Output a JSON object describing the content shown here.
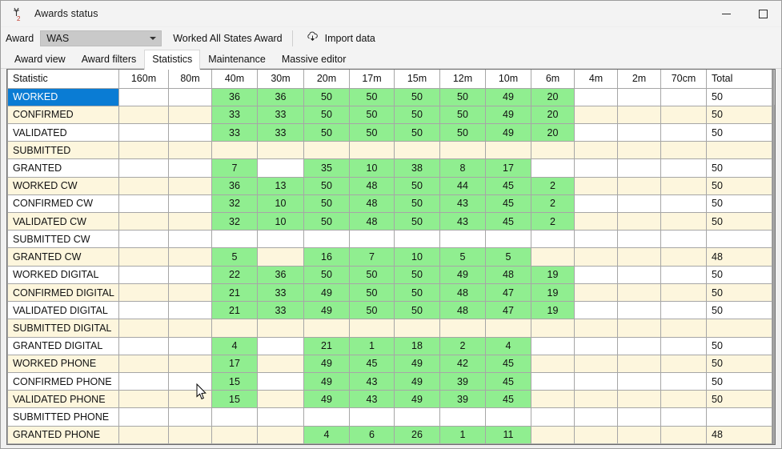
{
  "window": {
    "title": "Awards status",
    "icon": "antenna-icon",
    "minimize_label": "Minimize",
    "maximize_label": "Maximize"
  },
  "toolbar": {
    "award_label": "Award",
    "award_value": "WAS",
    "award_placeholder": "WAS",
    "award_description": "Worked All States Award",
    "import_label": "Import data",
    "import_icon": "cloud-download-icon"
  },
  "tabs": [
    {
      "label": "Award view",
      "active": false
    },
    {
      "label": "Award filters",
      "active": false
    },
    {
      "label": "Statistics",
      "active": true
    },
    {
      "label": "Maintenance",
      "active": false
    },
    {
      "label": "Massive editor",
      "active": false
    }
  ],
  "colors": {
    "green": "#90ee90",
    "cream": "#fdf6dd",
    "white": "#ffffff",
    "selection_blue": "#0a7cd4",
    "grid_line": "#a6a6a6"
  },
  "table": {
    "columns": [
      "Statistic",
      "160m",
      "80m",
      "40m",
      "30m",
      "20m",
      "17m",
      "15m",
      "12m",
      "10m",
      "6m",
      "4m",
      "2m",
      "70cm",
      "Total"
    ],
    "rows": [
      {
        "statistic": "WORKED",
        "selected": true,
        "values": [
          "",
          "",
          "36",
          "36",
          "50",
          "50",
          "50",
          "50",
          "49",
          "20",
          "",
          "",
          ""
        ],
        "total": "50"
      },
      {
        "statistic": "CONFIRMED",
        "selected": false,
        "values": [
          "",
          "",
          "33",
          "33",
          "50",
          "50",
          "50",
          "50",
          "49",
          "20",
          "",
          "",
          ""
        ],
        "total": "50"
      },
      {
        "statistic": "VALIDATED",
        "selected": false,
        "values": [
          "",
          "",
          "33",
          "33",
          "50",
          "50",
          "50",
          "50",
          "49",
          "20",
          "",
          "",
          ""
        ],
        "total": "50"
      },
      {
        "statistic": "SUBMITTED",
        "selected": false,
        "values": [
          "",
          "",
          "",
          "",
          "",
          "",
          "",
          "",
          "",
          "",
          "",
          "",
          ""
        ],
        "total": ""
      },
      {
        "statistic": "GRANTED",
        "selected": false,
        "values": [
          "",
          "",
          "7",
          "",
          "35",
          "10",
          "38",
          "8",
          "17",
          "",
          "",
          "",
          ""
        ],
        "total": "50"
      },
      {
        "statistic": "WORKED CW",
        "selected": false,
        "values": [
          "",
          "",
          "36",
          "13",
          "50",
          "48",
          "50",
          "44",
          "45",
          "2",
          "",
          "",
          ""
        ],
        "total": "50"
      },
      {
        "statistic": "CONFIRMED CW",
        "selected": false,
        "values": [
          "",
          "",
          "32",
          "10",
          "50",
          "48",
          "50",
          "43",
          "45",
          "2",
          "",
          "",
          ""
        ],
        "total": "50"
      },
      {
        "statistic": "VALIDATED CW",
        "selected": false,
        "values": [
          "",
          "",
          "32",
          "10",
          "50",
          "48",
          "50",
          "43",
          "45",
          "2",
          "",
          "",
          ""
        ],
        "total": "50"
      },
      {
        "statistic": "SUBMITTED CW",
        "selected": false,
        "values": [
          "",
          "",
          "",
          "",
          "",
          "",
          "",
          "",
          "",
          "",
          "",
          "",
          ""
        ],
        "total": ""
      },
      {
        "statistic": "GRANTED CW",
        "selected": false,
        "values": [
          "",
          "",
          "5",
          "",
          "16",
          "7",
          "10",
          "5",
          "5",
          "",
          "",
          "",
          ""
        ],
        "total": "48"
      },
      {
        "statistic": "WORKED DIGITAL",
        "selected": false,
        "values": [
          "",
          "",
          "22",
          "36",
          "50",
          "50",
          "50",
          "49",
          "48",
          "19",
          "",
          "",
          ""
        ],
        "total": "50"
      },
      {
        "statistic": "CONFIRMED DIGITAL",
        "selected": false,
        "values": [
          "",
          "",
          "21",
          "33",
          "49",
          "50",
          "50",
          "48",
          "47",
          "19",
          "",
          "",
          ""
        ],
        "total": "50"
      },
      {
        "statistic": "VALIDATED DIGITAL",
        "selected": false,
        "values": [
          "",
          "",
          "21",
          "33",
          "49",
          "50",
          "50",
          "48",
          "47",
          "19",
          "",
          "",
          ""
        ],
        "total": "50"
      },
      {
        "statistic": "SUBMITTED DIGITAL",
        "selected": false,
        "values": [
          "",
          "",
          "",
          "",
          "",
          "",
          "",
          "",
          "",
          "",
          "",
          "",
          ""
        ],
        "total": ""
      },
      {
        "statistic": "GRANTED DIGITAL",
        "selected": false,
        "values": [
          "",
          "",
          "4",
          "",
          "21",
          "1",
          "18",
          "2",
          "4",
          "",
          "",
          "",
          ""
        ],
        "total": "50"
      },
      {
        "statistic": "WORKED PHONE",
        "selected": false,
        "values": [
          "",
          "",
          "17",
          "",
          "49",
          "45",
          "49",
          "42",
          "45",
          "",
          "",
          "",
          ""
        ],
        "total": "50"
      },
      {
        "statistic": "CONFIRMED PHONE",
        "selected": false,
        "values": [
          "",
          "",
          "15",
          "",
          "49",
          "43",
          "49",
          "39",
          "45",
          "",
          "",
          "",
          ""
        ],
        "total": "50"
      },
      {
        "statistic": "VALIDATED PHONE",
        "selected": false,
        "values": [
          "",
          "",
          "15",
          "",
          "49",
          "43",
          "49",
          "39",
          "45",
          "",
          "",
          "",
          ""
        ],
        "total": "50"
      },
      {
        "statistic": "SUBMITTED PHONE",
        "selected": false,
        "values": [
          "",
          "",
          "",
          "",
          "",
          "",
          "",
          "",
          "",
          "",
          "",
          "",
          ""
        ],
        "total": ""
      },
      {
        "statistic": "GRANTED PHONE",
        "selected": false,
        "values": [
          "",
          "",
          "",
          "",
          "4",
          "6",
          "26",
          "1",
          "11",
          "",
          "",
          "",
          ""
        ],
        "total": "48"
      }
    ]
  }
}
